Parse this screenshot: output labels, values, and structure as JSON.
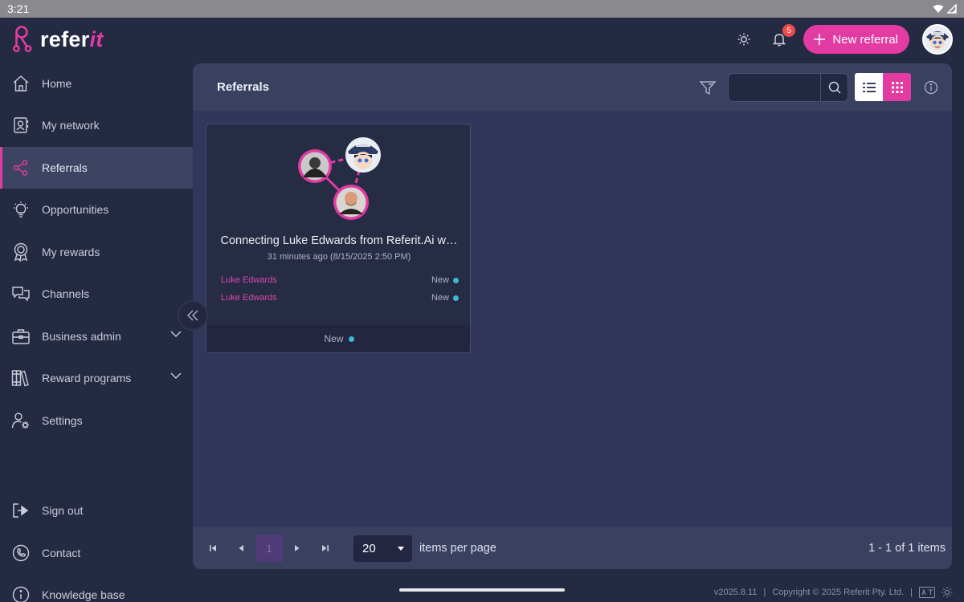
{
  "status_bar": {
    "time": "3:21"
  },
  "logo": {
    "text_main": "refer",
    "text_accent": "it"
  },
  "header": {
    "notification_count": "5",
    "new_referral_label": "New referral"
  },
  "sidebar": {
    "items": [
      {
        "label": "Home",
        "icon": "home-icon"
      },
      {
        "label": "My network",
        "icon": "contacts-icon"
      },
      {
        "label": "Referrals",
        "icon": "share-nodes-icon",
        "active": true
      },
      {
        "label": "Opportunities",
        "icon": "lightbulb-icon"
      },
      {
        "label": "My rewards",
        "icon": "award-icon"
      },
      {
        "label": "Channels",
        "icon": "chat-icon"
      },
      {
        "label": "Business admin",
        "icon": "briefcase-icon",
        "expandable": true
      },
      {
        "label": "Reward programs",
        "icon": "books-icon",
        "expandable": true
      },
      {
        "label": "Settings",
        "icon": "user-gear-icon"
      },
      {
        "label": "Sign out",
        "icon": "sign-out-icon"
      },
      {
        "label": "Contact",
        "icon": "phone-icon"
      },
      {
        "label": "Knowledge base",
        "icon": "info-icon"
      }
    ]
  },
  "main": {
    "title": "Referrals",
    "search": {
      "value": "",
      "placeholder": ""
    }
  },
  "card": {
    "title": "Connecting Luke Edwards from Referit.Ai w…",
    "time": "31 minutes ago (8/15/2025 2:50 PM)",
    "rows": [
      {
        "person": "Luke Edwards",
        "status": "New"
      },
      {
        "person": "Luke Edwards",
        "status": "New"
      }
    ],
    "footer_status": "New"
  },
  "pager": {
    "current_page": "1",
    "per_page": "20",
    "per_page_label": "items per page",
    "summary": "1 - 1 of 1 items"
  },
  "footer": {
    "version": "v2025.8.11",
    "copyright": "Copyright © 2025 Referit Pty. Ltd."
  },
  "colors": {
    "accent": "#e23ba2",
    "status_new": "#3fb6d3",
    "background": "#252a43",
    "panel": "#31365a"
  }
}
